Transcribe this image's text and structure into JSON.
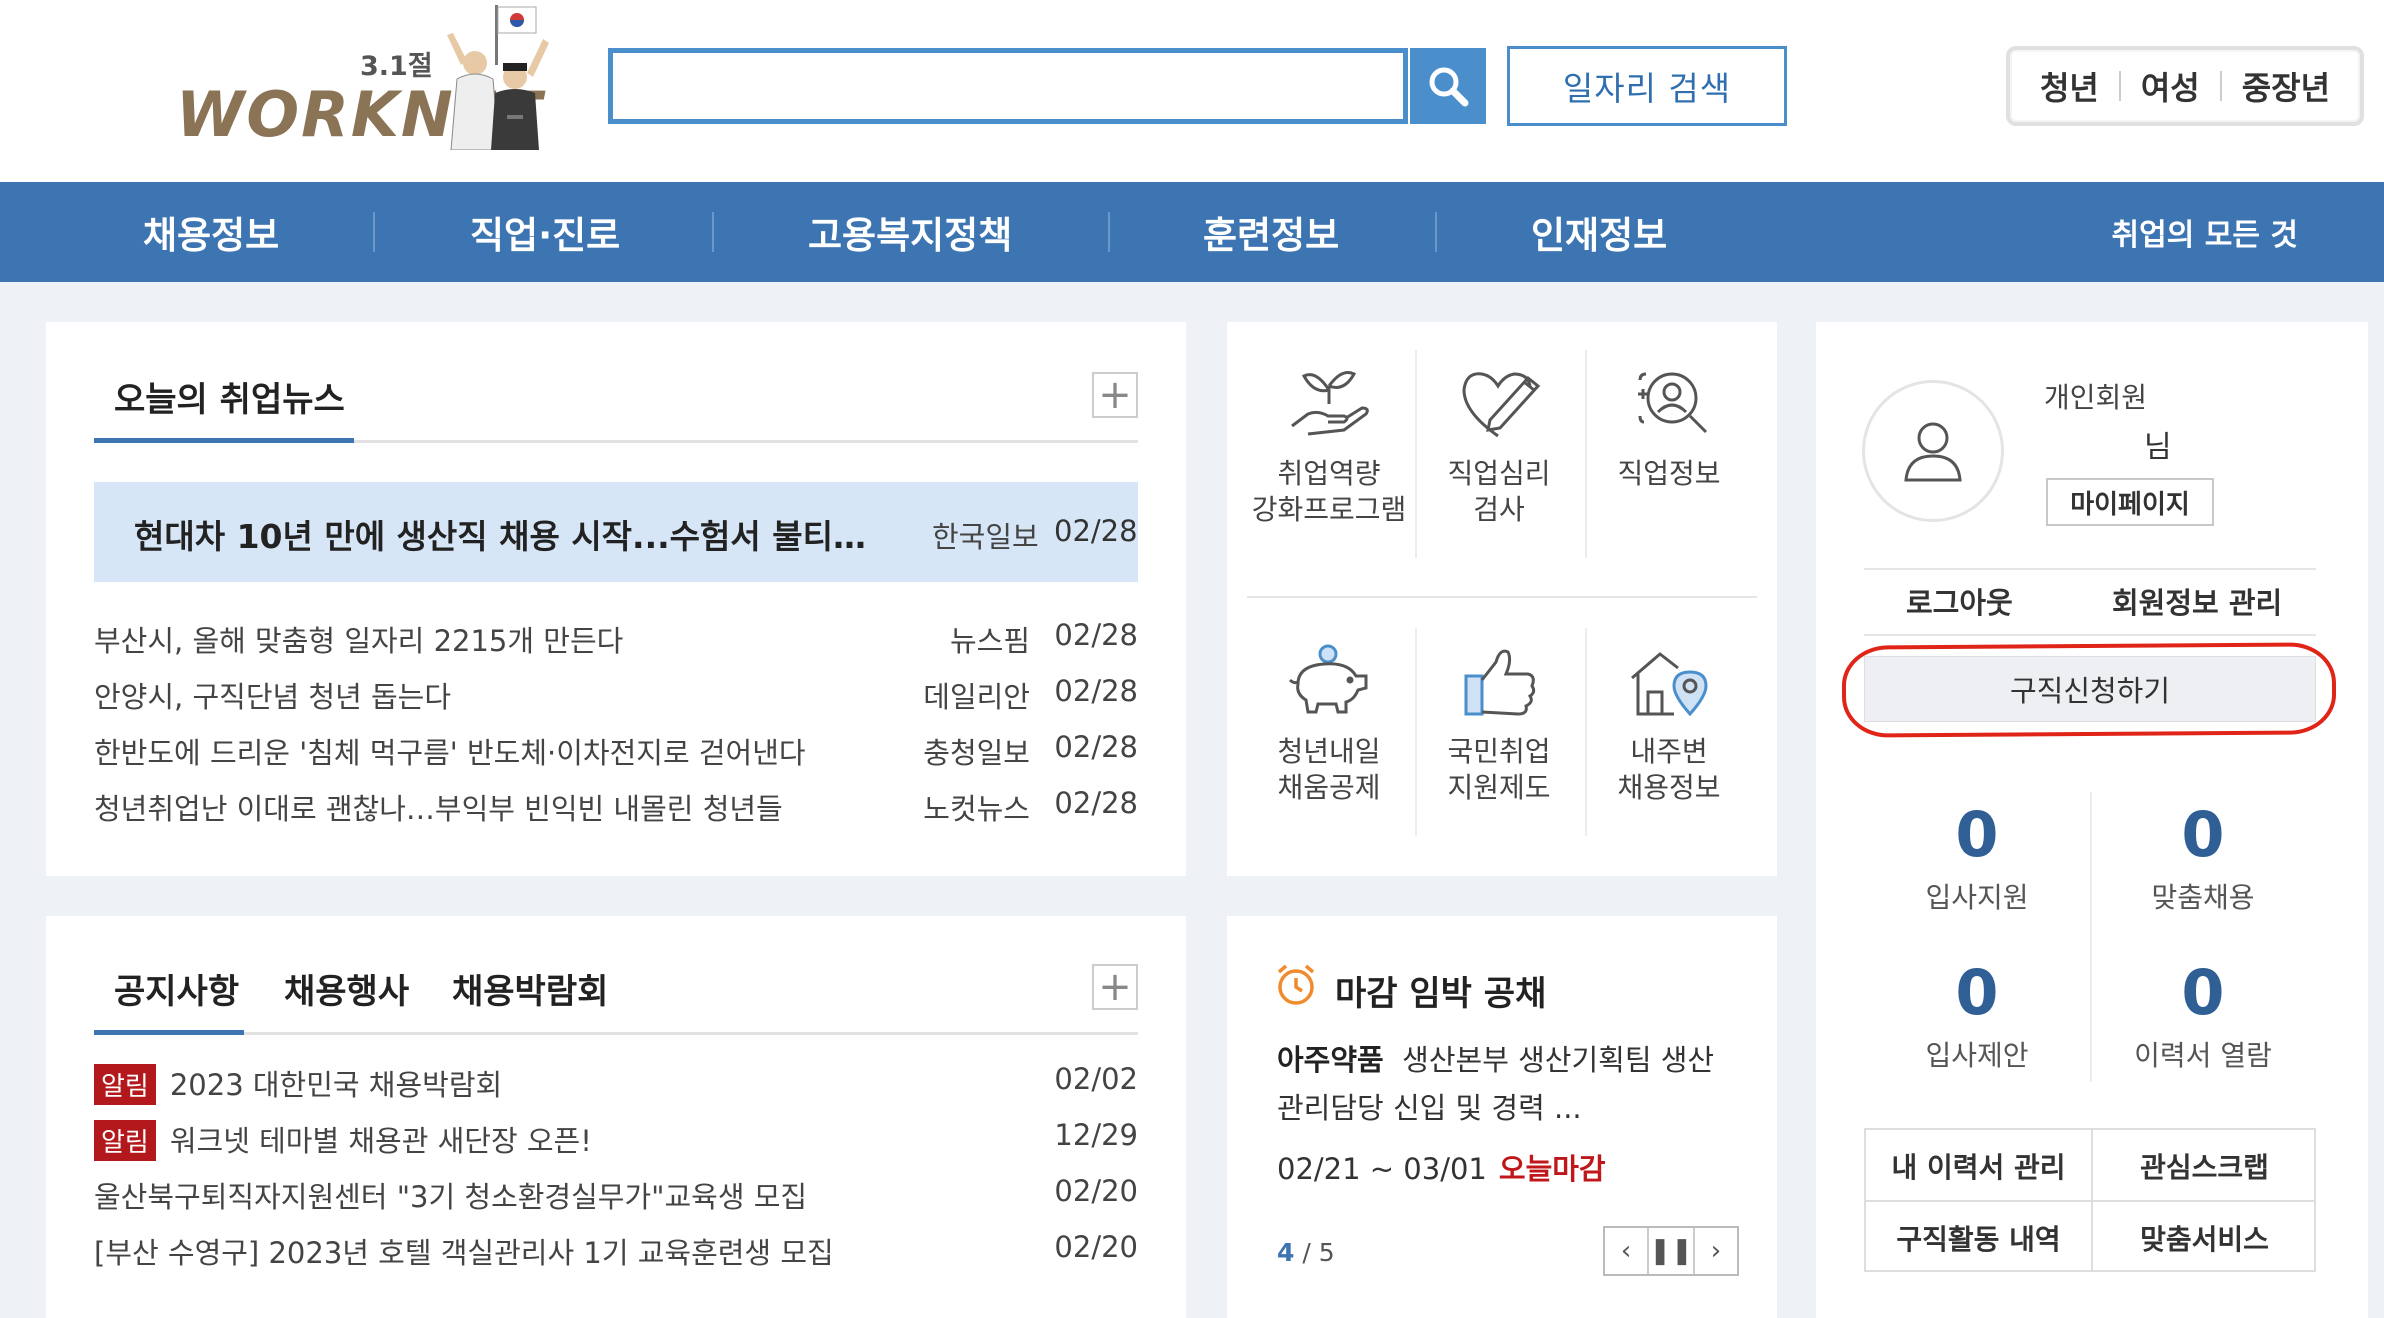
{
  "header": {
    "logo": {
      "event": "3.1절",
      "brand": "WORKNET"
    },
    "search": {
      "placeholder": "",
      "value": "",
      "button_icon": "search-icon"
    },
    "job_search_label": "일자리 검색",
    "age_groups": [
      "청년",
      "여성",
      "중장년"
    ]
  },
  "nav": {
    "items": [
      "채용정보",
      "직업·진로",
      "고용복지정책",
      "훈련정보",
      "인재정보"
    ],
    "right_label": "취업의 모든 것"
  },
  "news": {
    "title": "오늘의 취업뉴스",
    "headline": {
      "title": "현대차 10년 만에 생산직 채용 시작...수험서 불티…",
      "source": "한국일보",
      "date": "02/28"
    },
    "items": [
      {
        "title": "부산시, 올해 맞춤형 일자리 2215개 만든다",
        "source": "뉴스핌",
        "date": "02/28"
      },
      {
        "title": "안양시, 구직단념 청년 돕는다",
        "source": "데일리안",
        "date": "02/28"
      },
      {
        "title": "한반도에 드리운 '침체 먹구름' 반도체·이차전지로 걷어낸다",
        "source": "충청일보",
        "date": "02/28"
      },
      {
        "title": "청년취업난 이대로 괜찮나…부익부 빈익빈 내몰린 청년들",
        "source": "노컷뉴스",
        "date": "02/28"
      }
    ]
  },
  "quick_menu": {
    "items": [
      {
        "label_1": "취업역량",
        "label_2": "강화프로그램",
        "icon": "seedling-hand-icon"
      },
      {
        "label_1": "직업심리",
        "label_2": "검사",
        "icon": "heart-pen-icon"
      },
      {
        "label_1": "직업정보",
        "label_2": "",
        "icon": "person-search-icon"
      },
      {
        "label_1": "청년내일",
        "label_2": "채움공제",
        "icon": "piggy-bank-icon"
      },
      {
        "label_1": "국민취업",
        "label_2": "지원제도",
        "icon": "thumbs-up-icon"
      },
      {
        "label_1": "내주변",
        "label_2": "채용정보",
        "icon": "house-location-icon"
      }
    ]
  },
  "member": {
    "type": "개인회원",
    "name": "님",
    "mypage_label": "마이페이지",
    "logout_label": "로그아웃",
    "manage_label": "회원정보 관리",
    "apply_label": "구직신청하기",
    "stats": [
      {
        "value": "0",
        "label": "입사지원"
      },
      {
        "value": "0",
        "label": "맞춤채용"
      },
      {
        "value": "0",
        "label": "입사제안"
      },
      {
        "value": "0",
        "label": "이력서 열람"
      }
    ],
    "links": [
      "내 이력서 관리",
      "관심스크랩",
      "구직활동 내역",
      "맞춤서비스"
    ]
  },
  "notice": {
    "tabs": [
      "공지사항",
      "채용행사",
      "채용박람회"
    ],
    "items": [
      {
        "badge": "알림",
        "title": "2023 대한민국 채용박람회",
        "date": "02/02"
      },
      {
        "badge": "알림",
        "title": "워크넷 테마별 채용관 새단장 오픈!",
        "date": "12/29"
      },
      {
        "badge": "",
        "title": "울산북구퇴직자지원센터 \"3기 청소환경실무가\"교육생 모집",
        "date": "02/20"
      },
      {
        "badge": "",
        "title": "[부산 수영구] 2023년 호텔 객실관리사 1기 교육훈련생 모집",
        "date": "02/20"
      }
    ]
  },
  "deadline": {
    "title": "마감 임박 공채",
    "company": "아주약품",
    "description": "생산본부 생산기획팀 생산관리담당 신입 및 경력 ...",
    "period": "02/21 ~ 03/01",
    "status": "오늘마감",
    "page_current": "4",
    "page_total": "/ 5"
  },
  "colors": {
    "nav_bg": "#3d74b2",
    "accent": "#4a8fcb",
    "alert": "#b3191c",
    "highlight_circle": "#e02418"
  }
}
